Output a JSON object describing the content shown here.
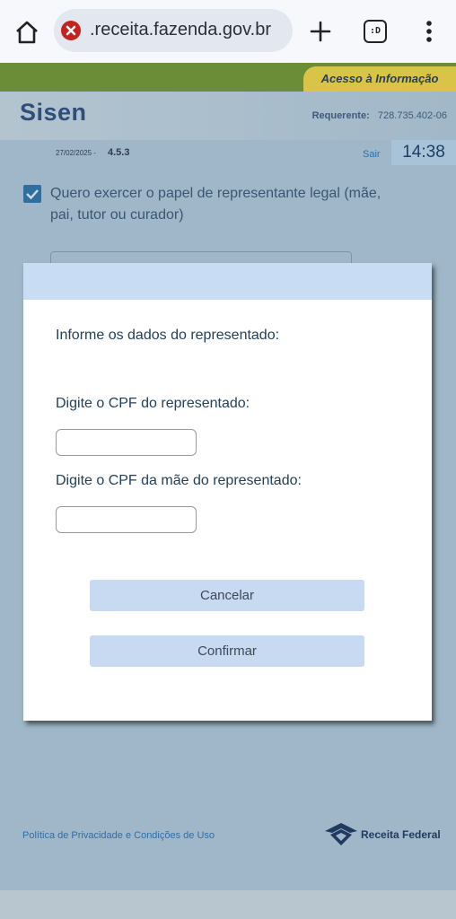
{
  "browser": {
    "url": ".receita.fazenda.gov.br",
    "tabs_label": ":D",
    "icons": [
      "home-icon",
      "site-error-icon",
      "new-tab-icon",
      "tabs-icon",
      "menu-icon"
    ],
    "error_color": "#c5221f"
  },
  "header": {
    "acesso_info": "Acesso à Informação",
    "logo": "Sisen",
    "requerente_label": "Requerente:",
    "requerente_value": "728.735.402-06",
    "date": "27/02/2025 -",
    "version": "4.5.3",
    "sair": "Sair",
    "clock": "14:38"
  },
  "background": {
    "checkbox_checked": true,
    "checkbox_label": "Quero exercer o papel de representante legal (mãe, pai, tutor ou curador)"
  },
  "dialog": {
    "prompt": "Informe os dados do representado:",
    "cpf_label": "Digite o CPF do representado:",
    "cpf_value": "",
    "mae_cpf_label": "Digite o CPF da mãe do representado:",
    "mae_cpf_value": "",
    "cancel_label": "Cancelar",
    "confirm_label": "Confirmar"
  },
  "footer": {
    "privacy_link": "Política de Privacidade e Condições de Uso",
    "receita_logo_text": "Receita Federal"
  },
  "colors": {
    "green_bar": "#6b8d38",
    "acesso_tab": "#d9c447",
    "dialog_accent": "#c8dcf3",
    "overlay": "#9fb7c8"
  }
}
